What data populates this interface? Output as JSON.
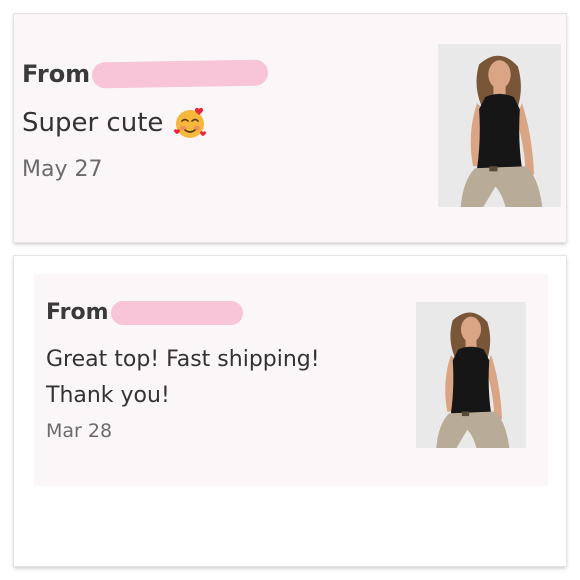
{
  "reviews": [
    {
      "from_label": "From",
      "message": "Super cute",
      "emoji_icon": "smiling-face-with-hearts-icon",
      "date": "May 27"
    },
    {
      "from_label": "From",
      "message": "Great top! Fast shipping! Thank you!",
      "date": "Mar 28"
    }
  ],
  "colors": {
    "redaction": "#f7c4d8",
    "card_background": "#fbf7f9"
  }
}
